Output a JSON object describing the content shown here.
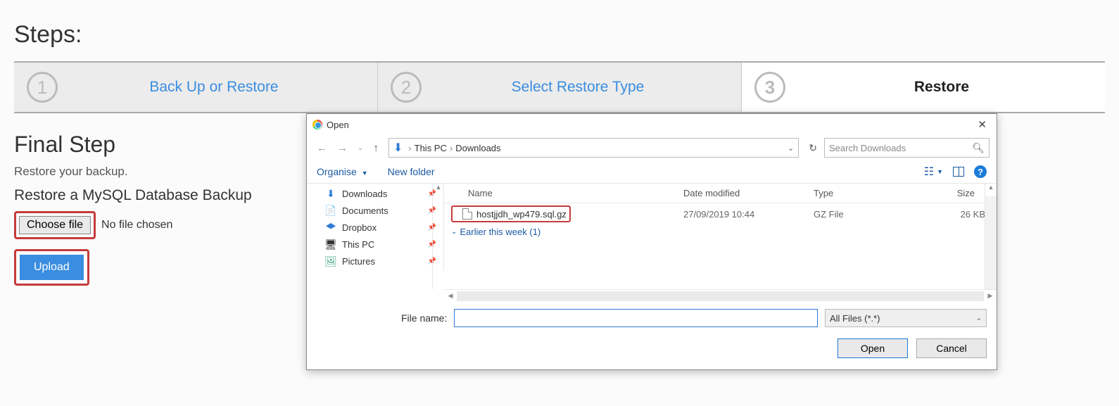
{
  "page_title": "Steps:",
  "steps": [
    {
      "num": "1",
      "label": "Back Up or Restore"
    },
    {
      "num": "2",
      "label": "Select Restore Type"
    },
    {
      "num": "3",
      "label": "Restore"
    }
  ],
  "final": {
    "title": "Final Step",
    "subtitle": "Restore your backup.",
    "heading": "Restore a MySQL Database Backup",
    "choose_label": "Choose file",
    "choose_status": "No file chosen",
    "upload_label": "Upload"
  },
  "dialog": {
    "title": "Open",
    "path": {
      "root": "This PC",
      "folder": "Downloads"
    },
    "search_placeholder": "Search Downloads",
    "toolbar": {
      "organise": "Organise",
      "new_folder": "New folder"
    },
    "sidebar": [
      {
        "icon": "down",
        "label": "Downloads"
      },
      {
        "icon": "doc",
        "label": "Documents"
      },
      {
        "icon": "drop",
        "label": "Dropbox"
      },
      {
        "icon": "pc",
        "label": "This PC"
      },
      {
        "icon": "pic",
        "label": "Pictures"
      }
    ],
    "columns": {
      "name": "Name",
      "date": "Date modified",
      "type": "Type",
      "size": "Size"
    },
    "files": [
      {
        "name": "hostjjdh_wp479.sql.gz",
        "date": "27/09/2019 10:44",
        "type": "GZ File",
        "size": "26 KB"
      }
    ],
    "group": "Earlier this week (1)",
    "file_name_label": "File name:",
    "filter": "All Files (*.*)",
    "open_btn": "Open",
    "cancel_btn": "Cancel"
  }
}
